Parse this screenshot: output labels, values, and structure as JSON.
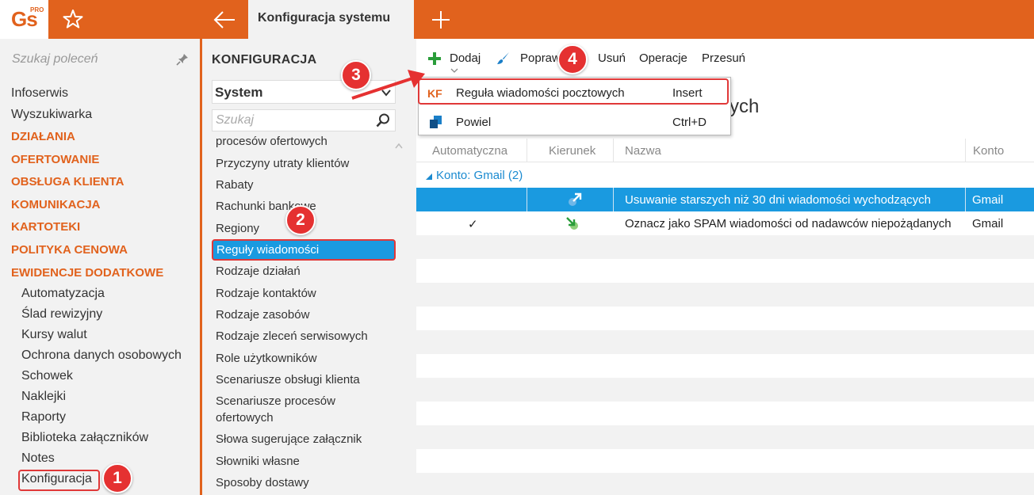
{
  "app": {
    "logo": "Gs",
    "logo_badge": "PRO",
    "tab_title": "Konfiguracja systemu"
  },
  "sidebar": {
    "search_placeholder": "Szukaj poleceń",
    "items": [
      {
        "label": "Infoserwis",
        "kind": "item"
      },
      {
        "label": "Wyszukiwarka",
        "kind": "item"
      },
      {
        "label": "DZIAŁANIA",
        "kind": "section"
      },
      {
        "label": "OFERTOWANIE",
        "kind": "section"
      },
      {
        "label": "OBSŁUGA KLIENTA",
        "kind": "section"
      },
      {
        "label": "KOMUNIKACJA",
        "kind": "section"
      },
      {
        "label": "KARTOTEKI",
        "kind": "section"
      },
      {
        "label": "POLITYKA CENOWA",
        "kind": "section"
      },
      {
        "label": "EWIDENCJE DODATKOWE",
        "kind": "section"
      },
      {
        "label": "Automatyzacja",
        "kind": "sub"
      },
      {
        "label": "Ślad rewizyjny",
        "kind": "sub"
      },
      {
        "label": "Kursy walut",
        "kind": "sub"
      },
      {
        "label": "Ochrona danych osobowych",
        "kind": "sub"
      },
      {
        "label": "Schowek",
        "kind": "sub"
      },
      {
        "label": "Naklejki",
        "kind": "sub"
      },
      {
        "label": "Raporty",
        "kind": "sub"
      },
      {
        "label": "Biblioteka załączników",
        "kind": "sub"
      },
      {
        "label": "Notes",
        "kind": "sub"
      },
      {
        "label": "Konfiguracja",
        "kind": "sub"
      }
    ]
  },
  "config": {
    "title": "KONFIGURACJA",
    "selected_group": "System",
    "search_placeholder": "Szukaj",
    "items": [
      "procesów ofertowych",
      "Przyczyny utraty klientów",
      "Rabaty",
      "Rachunki bankowe",
      "Regiony",
      "Reguły wiadomości",
      "Rodzaje działań",
      "Rodzaje kontaktów",
      "Rodzaje zasobów",
      "Rodzaje zleceń serwisowych",
      "Role użytkowników",
      "Scenariusze obsługi klienta",
      "Scenariusze procesów",
      "ofertowych",
      "Słowa sugerujące załącznik",
      "Słowniki własne",
      "Sposoby dostawy"
    ],
    "selected_item": "Reguły wiadomości"
  },
  "toolbar": {
    "add": "Dodaj",
    "edit": "Popraw",
    "delete": "Usuń",
    "operations": "Operacje",
    "move": "Przesuń"
  },
  "dropdown": {
    "items": [
      {
        "icon_text": "KF",
        "label": "Reguła wiadomości pocztowych",
        "shortcut": "Insert"
      },
      {
        "label": "Powiel",
        "shortcut": "Ctrl+D"
      }
    ]
  },
  "main": {
    "title_partial": "ych",
    "columns": [
      "Automatyczna",
      "Kierunek",
      "Nazwa",
      "Konto"
    ],
    "group": {
      "prefix": "Konto:",
      "name": "Gmail",
      "count": "(2)"
    },
    "rows": [
      {
        "auto": "",
        "direction": "outgoing",
        "name": "Usuwanie starszych niż 30 dni wiadomości wychodzących",
        "account": "Gmail",
        "selected": true
      },
      {
        "auto": "✓",
        "direction": "incoming",
        "name": "Oznacz jako SPAM wiadomości od nadawców niepożądanych",
        "account": "Gmail",
        "selected": false
      }
    ]
  },
  "badges": [
    "1",
    "2",
    "3",
    "4"
  ],
  "colors": {
    "accent": "#e1621d",
    "selection": "#1a9ae0",
    "highlight": "#e03838"
  }
}
